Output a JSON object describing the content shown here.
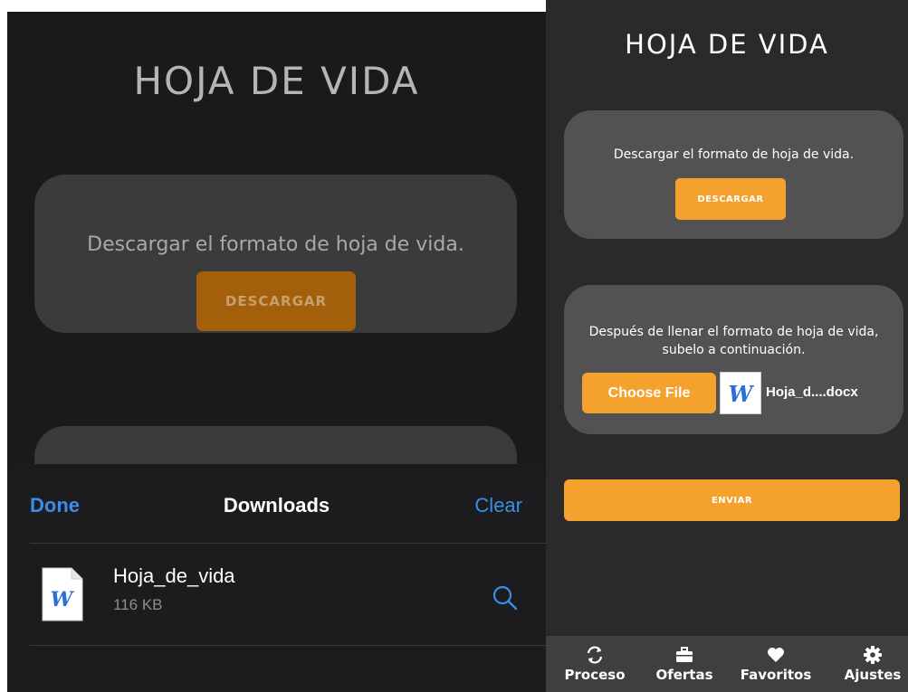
{
  "left": {
    "title": "HOJA DE VIDA",
    "card1": {
      "text": "Descargar el formato de hoja de vida.",
      "button": "DESCARGAR"
    },
    "downloads_sheet": {
      "done_label": "Done",
      "title": "Downloads",
      "clear_label": "Clear",
      "items": [
        {
          "name": "Hoja_de_vida",
          "size": "116 KB",
          "icon": "word-doc-icon"
        }
      ]
    }
  },
  "right": {
    "title": "HOJA DE VIDA",
    "card1": {
      "text": "Descargar el formato de hoja de vida.",
      "button": "DESCARGAR"
    },
    "card2": {
      "text": "Después de llenar el formato de hoja de vida, subelo a continuación.",
      "choose_button": "Choose File",
      "file_name": "Hoja_d....docx",
      "file_icon": "word-doc-icon"
    },
    "submit_button": "ENVIAR",
    "tabbar": [
      {
        "label": "Proceso",
        "icon": "refresh-icon"
      },
      {
        "label": "Ofertas",
        "icon": "briefcase-icon"
      },
      {
        "label": "Favoritos",
        "icon": "heart-icon"
      },
      {
        "label": "Ajustes",
        "icon": "gear-icon"
      }
    ]
  },
  "colors": {
    "accent": "#f5a12e",
    "ios_blue": "#3a8ee6",
    "dark_bg": "#1a1a1b",
    "card": "#525252"
  }
}
